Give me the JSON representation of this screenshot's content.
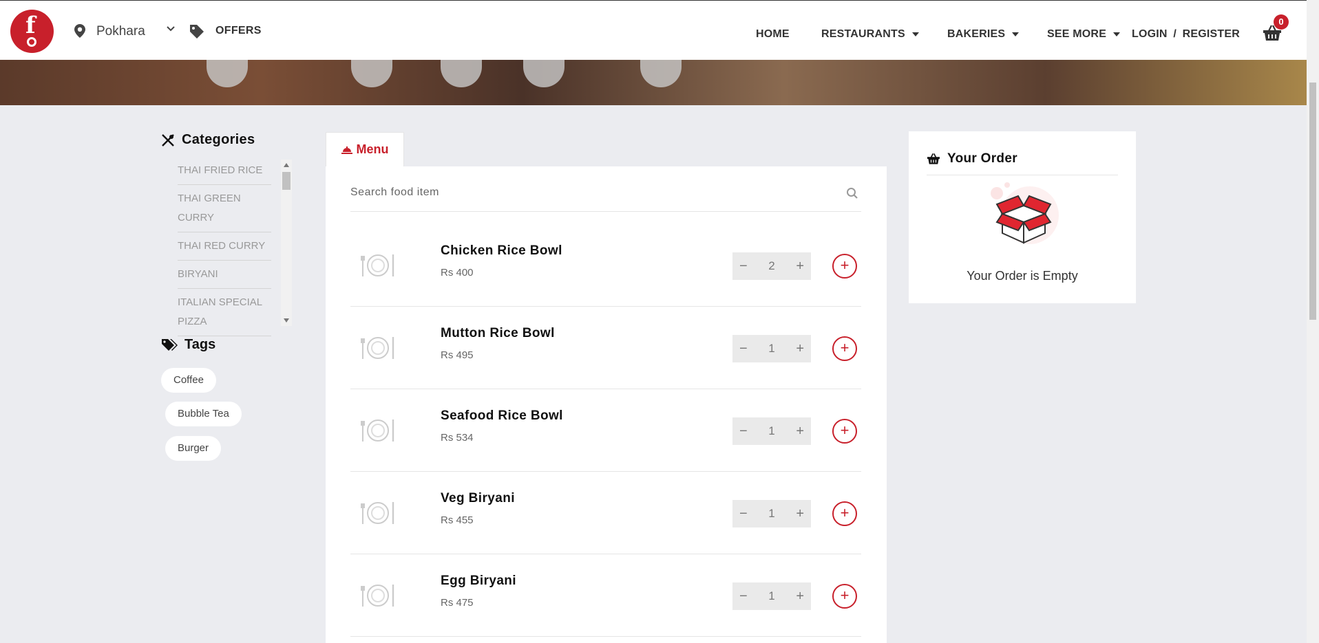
{
  "header": {
    "location": "Pokhara",
    "offers_label": "OFFERS",
    "nav": {
      "home": "HOME",
      "restaurants": "RESTAURANTS",
      "bakeries": "BAKERIES",
      "see_more": "SEE MORE",
      "login": "LOGIN",
      "sep": "/",
      "register": "REGISTER"
    },
    "cart_count": "0"
  },
  "sidebar": {
    "categories_title": "Categories",
    "categories": [
      "THAI FRIED RICE",
      "THAI GREEN CURRY",
      "THAI RED CURRY",
      "BIRYANI",
      "ITALIAN SPECIAL PIZZA"
    ],
    "tags_title": "Tags",
    "tags": [
      "Coffee",
      "Bubble Tea",
      "Burger"
    ]
  },
  "menu": {
    "tab_label": "Menu",
    "search_placeholder": "Search food item",
    "items": [
      {
        "name": "Chicken Rice Bowl",
        "price": "Rs 400",
        "qty": "2"
      },
      {
        "name": "Mutton Rice Bowl",
        "price": "Rs 495",
        "qty": "1"
      },
      {
        "name": "Seafood Rice Bowl",
        "price": "Rs 534",
        "qty": "1"
      },
      {
        "name": "Veg Biryani",
        "price": "Rs 455",
        "qty": "1"
      },
      {
        "name": "Egg Biryani",
        "price": "Rs 475",
        "qty": "1"
      }
    ],
    "minus_glyph": "−",
    "plus_glyph": "+"
  },
  "order": {
    "title": "Your Order",
    "empty_text": "Your Order is Empty"
  },
  "colors": {
    "brand": "#c8202b",
    "background": "#ebecf0"
  },
  "icons": {
    "location": "map-pin-icon",
    "offers": "tag-icon",
    "cart": "basket-icon",
    "categories": "utensils-icon",
    "tags": "tags-icon",
    "menu": "cloche-icon",
    "search": "search-icon",
    "order": "basket-icon"
  }
}
